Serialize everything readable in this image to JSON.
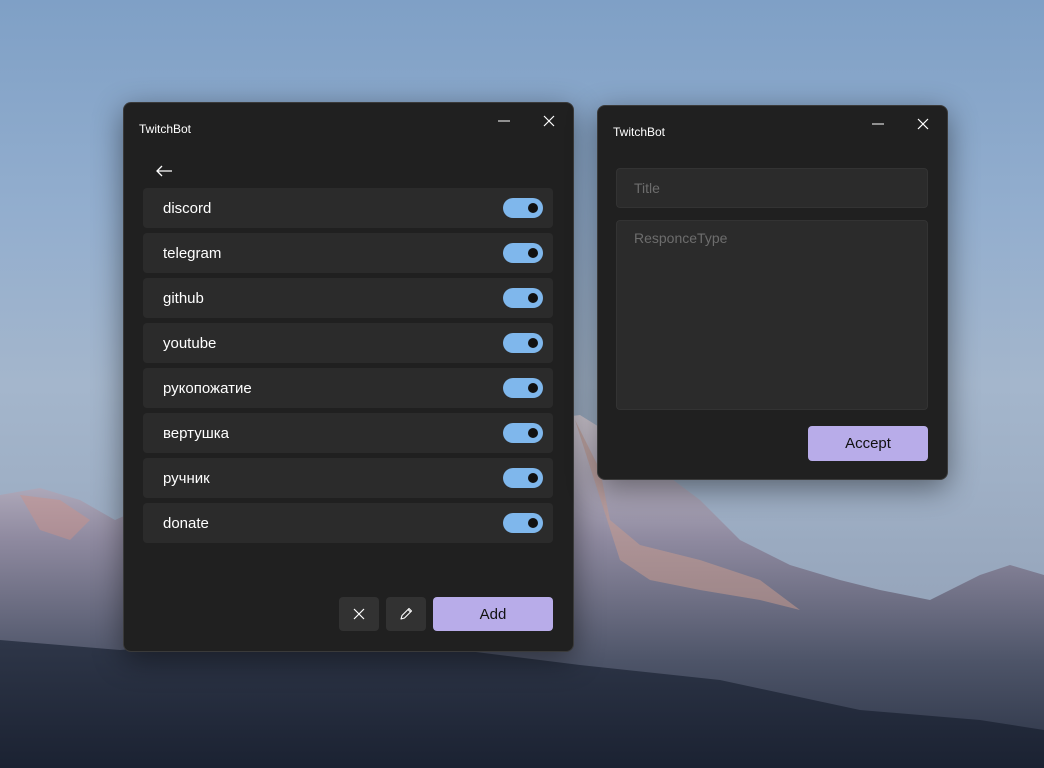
{
  "colors": {
    "accent": "#b8ace9",
    "toggle_on": "#7fb7ec",
    "window_bg": "#202020",
    "item_bg": "#2b2b2b"
  },
  "window_main": {
    "title": "TwitchBot",
    "icons": {
      "minimize": "minimize-icon",
      "close": "close-icon",
      "back": "arrow-left-icon"
    },
    "items": [
      {
        "label": "discord",
        "enabled": true
      },
      {
        "label": "telegram",
        "enabled": true
      },
      {
        "label": "github",
        "enabled": true
      },
      {
        "label": "youtube",
        "enabled": true
      },
      {
        "label": "рукопожатие",
        "enabled": true
      },
      {
        "label": "вертушка",
        "enabled": true
      },
      {
        "label": "ручник",
        "enabled": true
      },
      {
        "label": "donate",
        "enabled": true
      }
    ],
    "actions": {
      "delete_icon": "close-icon",
      "edit_icon": "pencil-icon",
      "add_label": "Add"
    }
  },
  "window_editor": {
    "title": "TwitchBot",
    "title_field": {
      "value": "",
      "placeholder": "Title"
    },
    "responce_field": {
      "value": "",
      "placeholder": "ResponceType"
    },
    "accept_label": "Accept"
  }
}
